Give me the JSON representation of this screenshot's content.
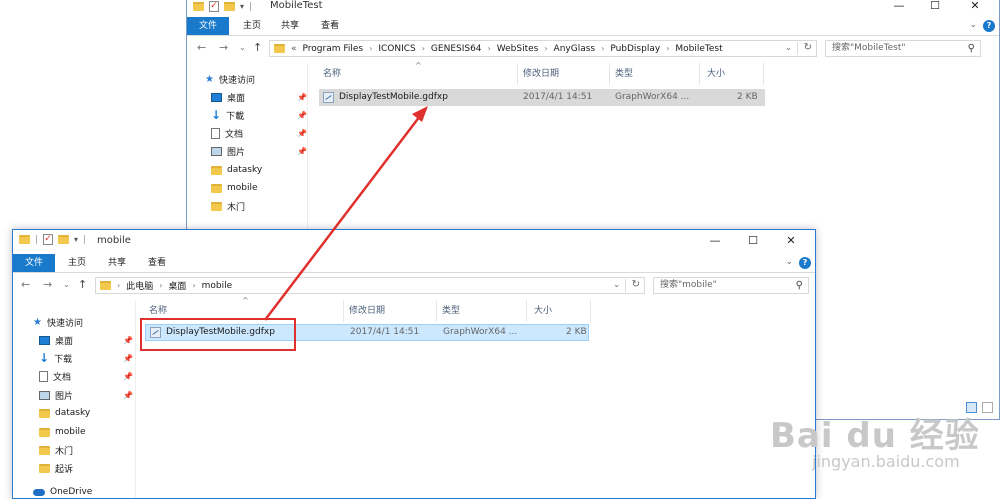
{
  "back_window": {
    "title": "MobileTest",
    "ribbon": {
      "file": "文件",
      "home": "主页",
      "share": "共享",
      "view": "查看"
    },
    "breadcrumb": [
      "«",
      "Program Files",
      "ICONICS",
      "GENESIS64",
      "WebSites",
      "AnyGlass",
      "PubDisplay",
      "MobileTest"
    ],
    "search_placeholder": "搜索\"MobileTest\"",
    "nav": {
      "quick_access": "快速访问",
      "desktop": "桌面",
      "downloads": "下載",
      "documents": "文档",
      "pictures": "图片",
      "folders": [
        "datasky",
        "mobile",
        "木门"
      ]
    },
    "columns": {
      "name": "名称",
      "modified": "修改日期",
      "type": "类型",
      "size": "大小"
    },
    "file": {
      "name": "DisplayTestMobile.gdfxp",
      "modified": "2017/4/1 14:51",
      "type": "GraphWorX64 ...",
      "size": "2 KB"
    }
  },
  "front_window": {
    "title": "mobile",
    "ribbon": {
      "file": "文件",
      "home": "主页",
      "share": "共享",
      "view": "查看"
    },
    "breadcrumb": [
      "此电脑",
      "桌面",
      "mobile"
    ],
    "search_placeholder": "搜索\"mobile\"",
    "nav": {
      "quick_access": "快速访问",
      "desktop": "桌面",
      "downloads": "下载",
      "documents": "文档",
      "pictures": "图片",
      "folders": [
        "datasky",
        "mobile",
        "木门",
        "起诉"
      ],
      "onedrive": "OneDrive"
    },
    "columns": {
      "name": "名称",
      "modified": "修改日期",
      "type": "类型",
      "size": "大小"
    },
    "file": {
      "name": "DisplayTestMobile.gdfxp",
      "modified": "2017/4/1 14:51",
      "type": "GraphWorX64 ...",
      "size": "2 KB"
    }
  },
  "watermark": {
    "brand": "Bai du 经验",
    "url": "jingyan.baidu.com"
  },
  "colors": {
    "accent": "#1979ca",
    "annotation": "#e0302e",
    "selected_row": "#cce8ff"
  }
}
